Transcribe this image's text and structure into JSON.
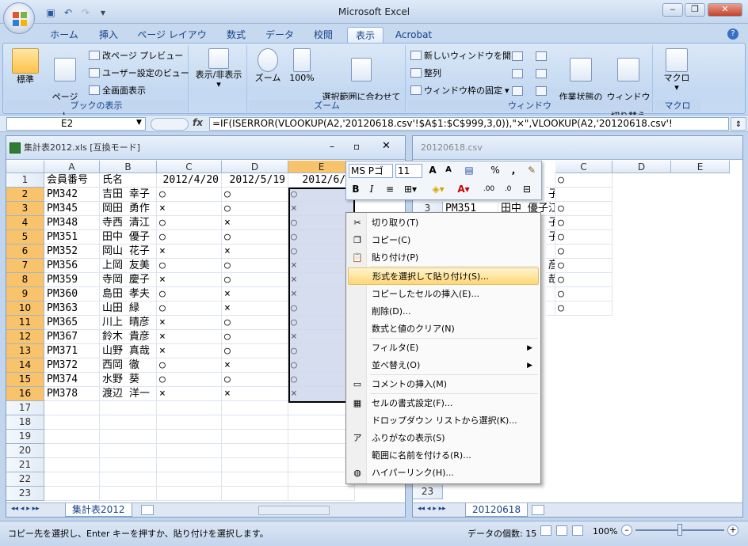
{
  "app": {
    "title": "Microsoft Excel"
  },
  "qat": {
    "save": "save-icon",
    "undo": "undo-icon",
    "redo": "redo-icon"
  },
  "ribbon": {
    "tabs": [
      "ホーム",
      "挿入",
      "ページ レイアウト",
      "数式",
      "データ",
      "校閲",
      "表示",
      "Acrobat"
    ],
    "active_tab": "表示",
    "groups": {
      "book_view": {
        "title": "ブックの表示",
        "normal": "標準",
        "page_layout": "ページ\nレイアウト",
        "page_break": "改ページ プレビュー",
        "custom_view": "ユーザー設定のビュー",
        "full_screen": "全画面表示"
      },
      "show_hide": {
        "label": "表示/非表示"
      },
      "zoom": {
        "title": "ズーム",
        "zoom": "ズーム",
        "hundred": "100%",
        "fit": "選択範囲に合わせて\n拡大/縮小"
      },
      "window": {
        "title": "ウィンドウ",
        "new_window": "新しいウィンドウを開く",
        "arrange": "整列",
        "freeze": "ウィンドウ枠の固定",
        "save_ws": "作業状態の\n保存",
        "switch": "ウィンドウの\n切り替え"
      },
      "macro": {
        "title": "マクロ",
        "macro": "マクロ"
      }
    }
  },
  "formula_bar": {
    "name_box": "E2",
    "fx": "fx",
    "formula": "=IF(ISERROR(VLOOKUP(A2,'20120618.csv'!$A$1:$C$999,3,0)),\"×\",VLOOKUP(A2,'20120618.csv'!"
  },
  "left_window": {
    "title": "集計表2012.xls [互換モード]",
    "columns": [
      "A",
      "B",
      "C",
      "D",
      "E"
    ],
    "header_row": [
      "会員番号",
      "氏名",
      "2012/4/20",
      "2012/5/19",
      "2012/6/1"
    ],
    "rows": [
      [
        "PM342",
        "吉田 幸子",
        "○",
        "○",
        "○"
      ],
      [
        "PM345",
        "岡田 勇作",
        "×",
        "○",
        "×"
      ],
      [
        "PM348",
        "寺西 清江",
        "○",
        "×",
        "○"
      ],
      [
        "PM351",
        "田中 優子",
        "○",
        "○",
        "○"
      ],
      [
        "PM352",
        "岡山 花子",
        "×",
        "×",
        "○"
      ],
      [
        "PM356",
        "上岡 友美",
        "○",
        "○",
        "×"
      ],
      [
        "PM359",
        "寺岡 慶子",
        "×",
        "○",
        "×"
      ],
      [
        "PM360",
        "島田 孝夫",
        "○",
        "×",
        "×"
      ],
      [
        "PM363",
        "山田 緑",
        "○",
        "×",
        "○"
      ],
      [
        "PM365",
        "川上 晴彦",
        "×",
        "○",
        "○"
      ],
      [
        "PM367",
        "鈴木 貴彦",
        "×",
        "○",
        "×"
      ],
      [
        "PM371",
        "山野 真哉",
        "×",
        "○",
        "○"
      ],
      [
        "PM372",
        "西岡 徹",
        "○",
        "×",
        "○"
      ],
      [
        "PM374",
        "水野 葵",
        "○",
        "○",
        "○"
      ],
      [
        "PM378",
        "渡辺 洋一",
        "×",
        "×",
        "×"
      ]
    ],
    "row_numbers": [
      "1",
      "2",
      "3",
      "4",
      "5",
      "6",
      "7",
      "8",
      "9",
      "10",
      "11",
      "12",
      "13",
      "14",
      "15",
      "16",
      "17",
      "18",
      "19",
      "20",
      "21",
      "22",
      "23"
    ],
    "sheet_tab": "集計表2012"
  },
  "right_window": {
    "title": "20120618.csv",
    "columns": [
      "C",
      "D",
      "E"
    ],
    "visible_row": {
      "num": "3",
      "id": "PM351",
      "name": "田中 優子"
    },
    "b_partial": [
      "子",
      "江",
      "子",
      "子",
      "",
      "彦",
      "哉",
      "",
      ""
    ],
    "c_values": [
      "○",
      "",
      "○",
      "○",
      "○",
      "○",
      "○",
      "○",
      "○",
      "○"
    ],
    "row_23": "23",
    "sheet_tab": "20120618"
  },
  "mini_toolbar": {
    "font": "MS Pゴ",
    "size": "11",
    "bold": "B",
    "italic": "I",
    "percent": "%",
    "comma": ","
  },
  "context_menu": [
    {
      "label": "切り取り(T)",
      "icon": "scissors-icon"
    },
    {
      "label": "コピー(C)",
      "icon": "copy-icon"
    },
    {
      "label": "貼り付け(P)",
      "icon": "paste-icon"
    },
    {
      "label": "形式を選択して貼り付け(S)...",
      "icon": "",
      "highlight": true
    },
    {
      "label": "コピーしたセルの挿入(E)...",
      "icon": ""
    },
    {
      "label": "削除(D)...",
      "icon": ""
    },
    {
      "label": "数式と値のクリア(N)",
      "icon": ""
    },
    {
      "label": "フィルタ(E)",
      "icon": "",
      "submenu": true
    },
    {
      "label": "並べ替え(O)",
      "icon": "",
      "submenu": true
    },
    {
      "label": "コメントの挿入(M)",
      "icon": "comment-icon"
    },
    {
      "label": "セルの書式設定(F)...",
      "icon": "format-cells-icon"
    },
    {
      "label": "ドロップダウン リストから選択(K)...",
      "icon": ""
    },
    {
      "label": "ふりがなの表示(S)",
      "icon": "furigana-icon"
    },
    {
      "label": "範囲に名前を付ける(R)...",
      "icon": ""
    },
    {
      "label": "ハイパーリンク(H)...",
      "icon": "hyperlink-icon"
    }
  ],
  "status": {
    "message": "コピー先を選択し、Enter キーを押すか、貼り付けを選択します。",
    "count": "データの個数: 15",
    "zoom": "100%"
  },
  "colors": {
    "accent": "#15428b",
    "selected_header": "#f9c36b",
    "highlight": "#ffd775"
  }
}
